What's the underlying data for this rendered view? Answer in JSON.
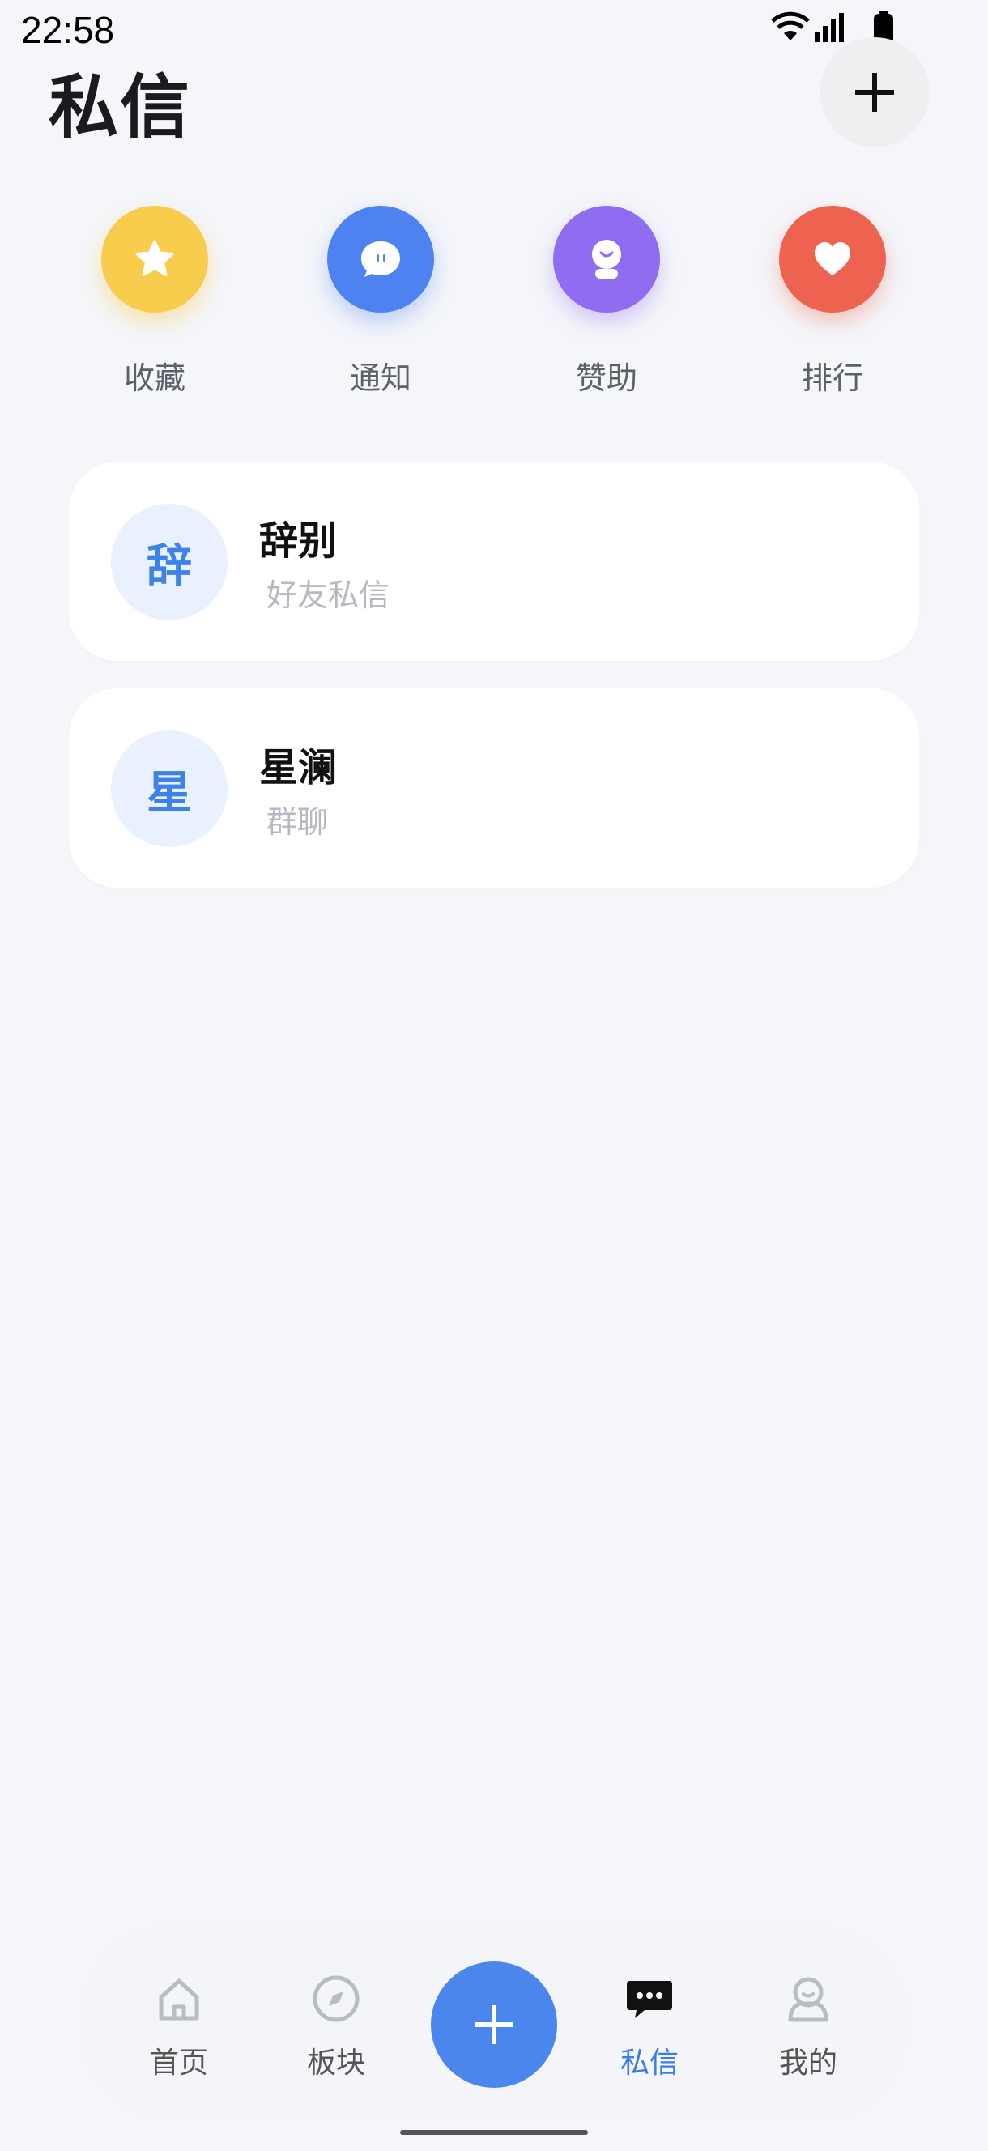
{
  "status_bar": {
    "time": "22:58"
  },
  "header": {
    "title": "私信",
    "add_icon": "plus-icon"
  },
  "quick_actions": [
    {
      "label": "收藏",
      "icon": "star-icon",
      "color": "#f8cd4d"
    },
    {
      "label": "通知",
      "icon": "chat-bubble-icon",
      "color": "#4f82f1"
    },
    {
      "label": "赞助",
      "icon": "sponsor-icon",
      "color": "#8f6cf0"
    },
    {
      "label": "排行",
      "icon": "heart-icon",
      "color": "#ee6350"
    }
  ],
  "conversations": [
    {
      "avatar_text": "辞",
      "name": "辞别",
      "subtitle": "好友私信"
    },
    {
      "avatar_text": "星",
      "name": "星澜",
      "subtitle": "群聊"
    }
  ],
  "bottom_nav": {
    "items": [
      {
        "label": "首页",
        "icon": "home-icon"
      },
      {
        "label": "板块",
        "icon": "compass-icon"
      },
      {
        "label": "私信",
        "icon": "message-icon",
        "active": true
      },
      {
        "label": "我的",
        "icon": "profile-icon"
      }
    ],
    "fab_icon": "plus-icon"
  },
  "colors": {
    "accent": "#4a86ec",
    "background": "#f5f6fa"
  }
}
